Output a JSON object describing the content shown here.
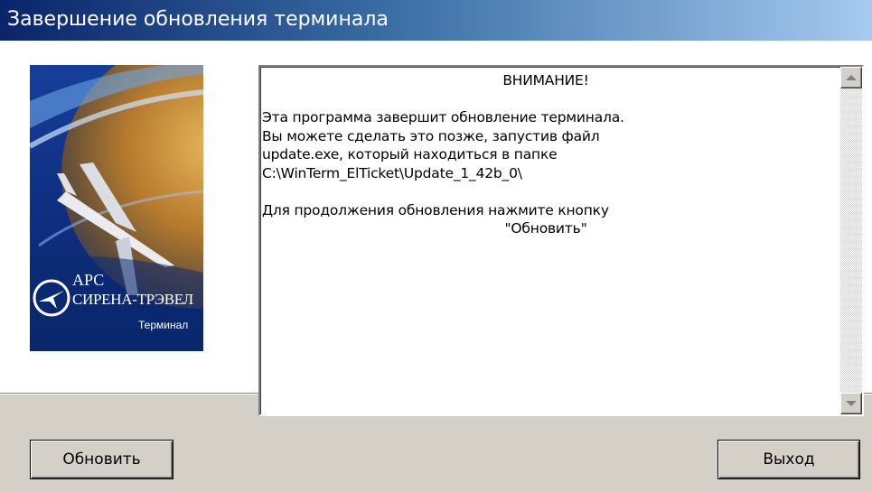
{
  "window": {
    "title": "Завершение обновления терминала"
  },
  "logo": {
    "line1": "АРС",
    "line2": "СИРЕНА-ТРЭВЕЛ",
    "line3": "Терминал"
  },
  "message": {
    "lines": [
      "ВНИМАНИЕ!",
      "",
      "Эта программа завершит обновление терминала.",
      "Вы можете сделать это позже, запустив файл",
      "update.exe, который находиться в папке",
      "C:\\WinTerm_ElTicket\\Update_1_42b_0\\",
      "",
      "Для продолжения обновления нажмите кнопку",
      "\"Обновить\""
    ]
  },
  "buttons": {
    "update": "Обновить",
    "exit": "Выход"
  },
  "colors": {
    "titlebar_start": "#0a246a",
    "titlebar_end": "#a6caf0",
    "logo_background": "#0d2f7a"
  }
}
